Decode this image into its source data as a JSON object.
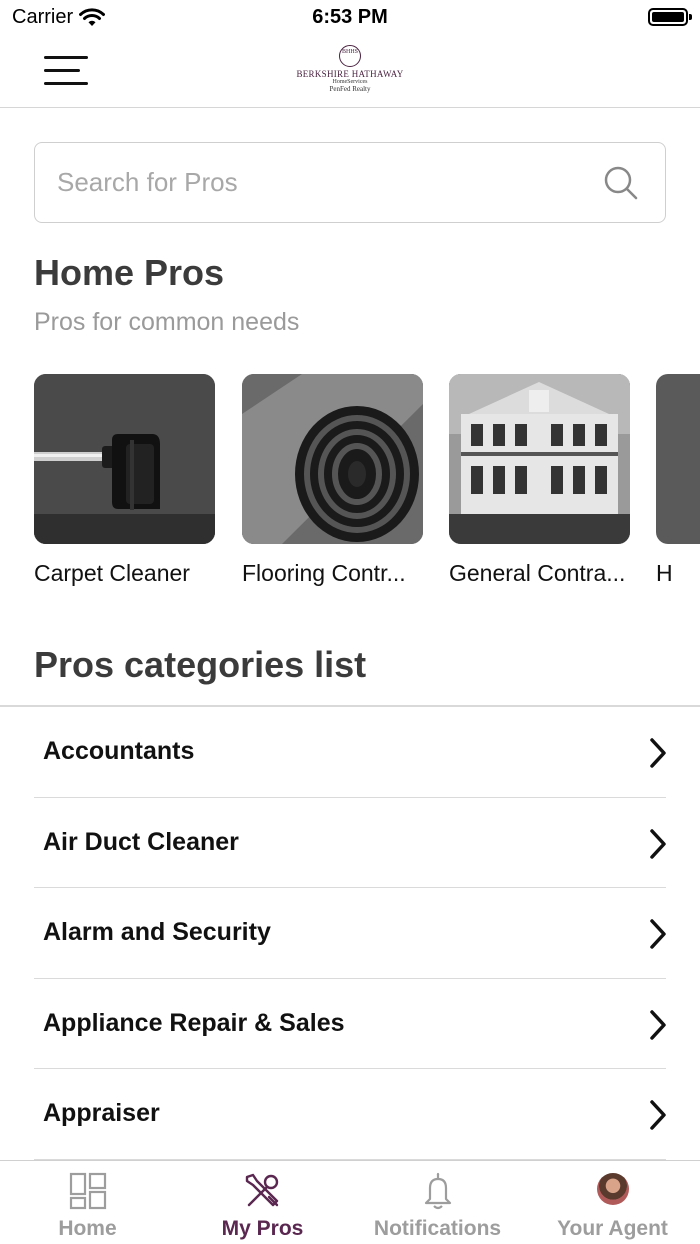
{
  "status_bar": {
    "carrier": "Carrier",
    "time": "6:53 PM"
  },
  "header": {
    "logo": {
      "line1": "BERKSHIRE HATHAWAY",
      "line2": "HomeServices",
      "line3": "PenFed Realty",
      "seal": "BHHS"
    }
  },
  "search": {
    "placeholder": "Search for Pros",
    "value": ""
  },
  "home_pros": {
    "title": "Home Pros",
    "subtitle": "Pros for common needs",
    "cards": [
      {
        "label": "Carpet Cleaner",
        "image": "vacuum-photo"
      },
      {
        "label": "Flooring Contr...",
        "image": "rolled-rug-photo"
      },
      {
        "label": "General Contra...",
        "image": "house-photo"
      },
      {
        "label": "H",
        "image": "partial-photo"
      }
    ]
  },
  "categories": {
    "title": "Pros categories list",
    "items": [
      {
        "label": "Accountants"
      },
      {
        "label": "Air Duct Cleaner"
      },
      {
        "label": "Alarm and Security"
      },
      {
        "label": "Appliance Repair & Sales"
      },
      {
        "label": "Appraiser"
      }
    ]
  },
  "tab_bar": {
    "active": "My Pros",
    "active_color": "#5a2750",
    "inactive_color": "#9d9d9d",
    "tabs": [
      {
        "label": "Home",
        "icon": "grid-icon"
      },
      {
        "label": "My Pros",
        "icon": "tools-icon"
      },
      {
        "label": "Notifications",
        "icon": "bell-icon"
      },
      {
        "label": "Your Agent",
        "icon": "agent-avatar"
      }
    ]
  }
}
